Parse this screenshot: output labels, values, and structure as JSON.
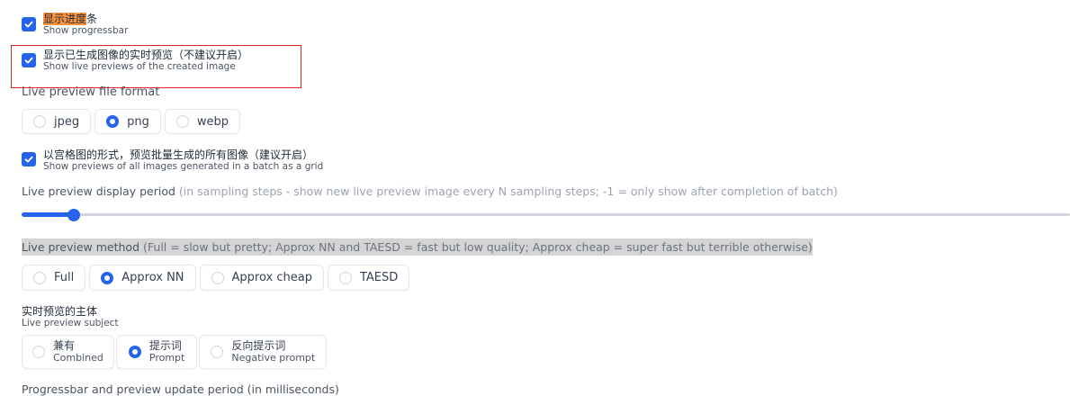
{
  "progressbar": {
    "checked": true,
    "label_highlight": "显示进度",
    "label_rest": "条",
    "sub": "Show progressbar"
  },
  "live_previews": {
    "checked": true,
    "label": "显示已生成图像的实时预览（不建议开启）",
    "sub": "Show live previews of the created image"
  },
  "file_format": {
    "title": "Live preview file format",
    "options": [
      "jpeg",
      "png",
      "webp"
    ],
    "selected": "png"
  },
  "grid_preview": {
    "checked": true,
    "label": "以宫格图的形式，预览批量生成的所有图像（建议开启）",
    "sub": "Show previews of all images generated in a batch as a grid"
  },
  "display_period": {
    "title": "Live preview display period",
    "hint": "(in sampling steps - show new live preview image every N sampling steps; -1 = only show after completion of batch)",
    "slider_fraction": 0.05
  },
  "method": {
    "title": "Live preview method",
    "hint": "(Full = slow but pretty; Approx NN and TAESD = fast but low quality; Approx cheap = super fast but terrible otherwise)",
    "options": [
      "Full",
      "Approx NN",
      "Approx cheap",
      "TAESD"
    ],
    "selected": "Approx NN"
  },
  "subject": {
    "title": "实时预览的主体",
    "sub": "Live preview subject",
    "options": [
      {
        "label": "兼有",
        "sub": "Combined"
      },
      {
        "label": "提示词",
        "sub": "Prompt"
      },
      {
        "label": "反向提示词",
        "sub": "Negative prompt"
      }
    ],
    "selected": "Prompt"
  },
  "next_truncated": "Progressbar and preview update period (in milliseconds)",
  "colors": {
    "accent": "#2563eb",
    "highlight": "#fb923c",
    "annotation": "#dc2626"
  }
}
